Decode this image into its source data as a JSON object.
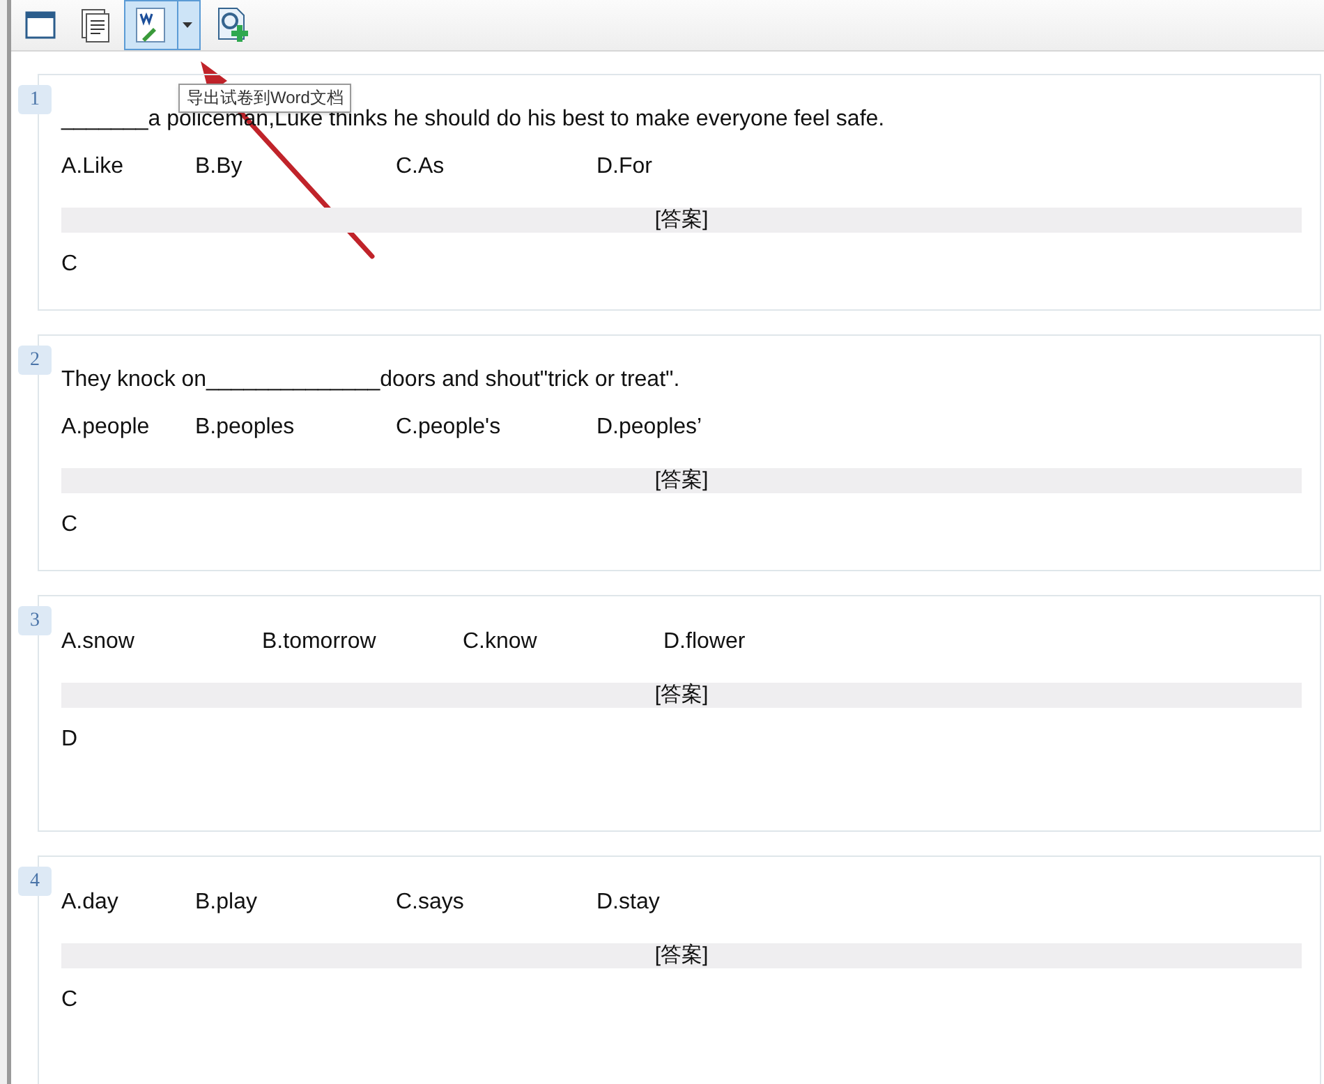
{
  "toolbar": {
    "buttons": [
      {
        "kind": "window",
        "selected": false
      },
      {
        "kind": "document",
        "selected": false
      },
      {
        "kind": "word",
        "selected": true
      },
      {
        "kind": "add",
        "selected": false
      }
    ],
    "tooltip": "导出试卷到Word文档"
  },
  "questions": [
    {
      "number": "1",
      "stem": "_______a policeman,Luke thinks he should do his best to make everyone feel safe.",
      "kind": "tabbed",
      "options": [
        "A.Like",
        "B.By",
        "C.As",
        "D.For"
      ],
      "answer_label": "[答案]",
      "answer": "C"
    },
    {
      "number": "2",
      "stem": "They knock on______________doors and shout\"trick or treat\".",
      "kind": "tabbed",
      "options": [
        "A.people",
        "B.peoples",
        "C.people's",
        "D.peoples’"
      ],
      "answer_label": "[答案]",
      "answer": "C"
    },
    {
      "number": "3",
      "kind": "even",
      "options": [
        "A.snow",
        "B.tomorrow",
        "C.know",
        "D.flower"
      ],
      "answer_label": "[答案]",
      "answer": "D"
    },
    {
      "number": "4",
      "kind": "tabbed",
      "options": [
        "A.day",
        "B.play",
        "C.says",
        "D.stay"
      ],
      "answer_label": "[答案]",
      "answer": "C"
    }
  ],
  "annotation": {
    "kind": "arrow"
  }
}
